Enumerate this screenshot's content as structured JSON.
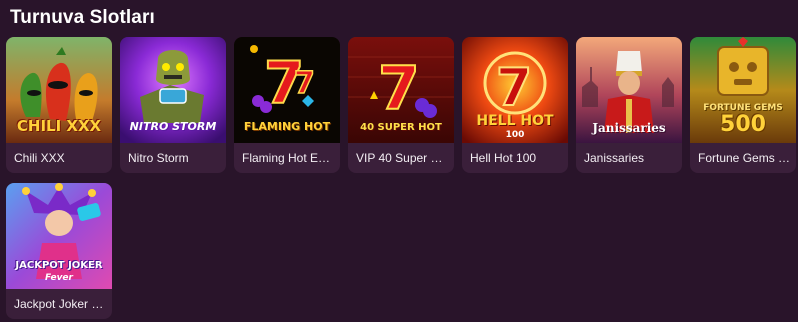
{
  "section": {
    "title": "Turnuva Slotları"
  },
  "games": [
    {
      "name": "Chili XXX",
      "logo": "CHILI XXX",
      "icon": "chili-peppers-icon"
    },
    {
      "name": "Nitro Storm",
      "logo": "NITRO STORM",
      "icon": "robot-skull-icon"
    },
    {
      "name": "Flaming Hot Ext…",
      "logo": "FLAMING HOT",
      "icon": "lucky-seven-icon"
    },
    {
      "name": "VIP 40 Super H…",
      "logo": "40 SUPER HOT",
      "icon": "lucky-seven-icon"
    },
    {
      "name": "Hell Hot 100",
      "logo": "HELL HOT",
      "badge": "100",
      "icon": "flaming-seven-icon"
    },
    {
      "name": "Janissaries",
      "logo": "Janissaries",
      "icon": "janissary-warrior-icon"
    },
    {
      "name": "Fortune Gems 5…",
      "logo": "FORTUNE GEMS",
      "badge": "500",
      "icon": "golden-idol-icon"
    },
    {
      "name": "Jackpot Joker F…",
      "logo": "JACKPOT JOKER",
      "badge": "Fever",
      "icon": "jester-icon"
    }
  ]
}
